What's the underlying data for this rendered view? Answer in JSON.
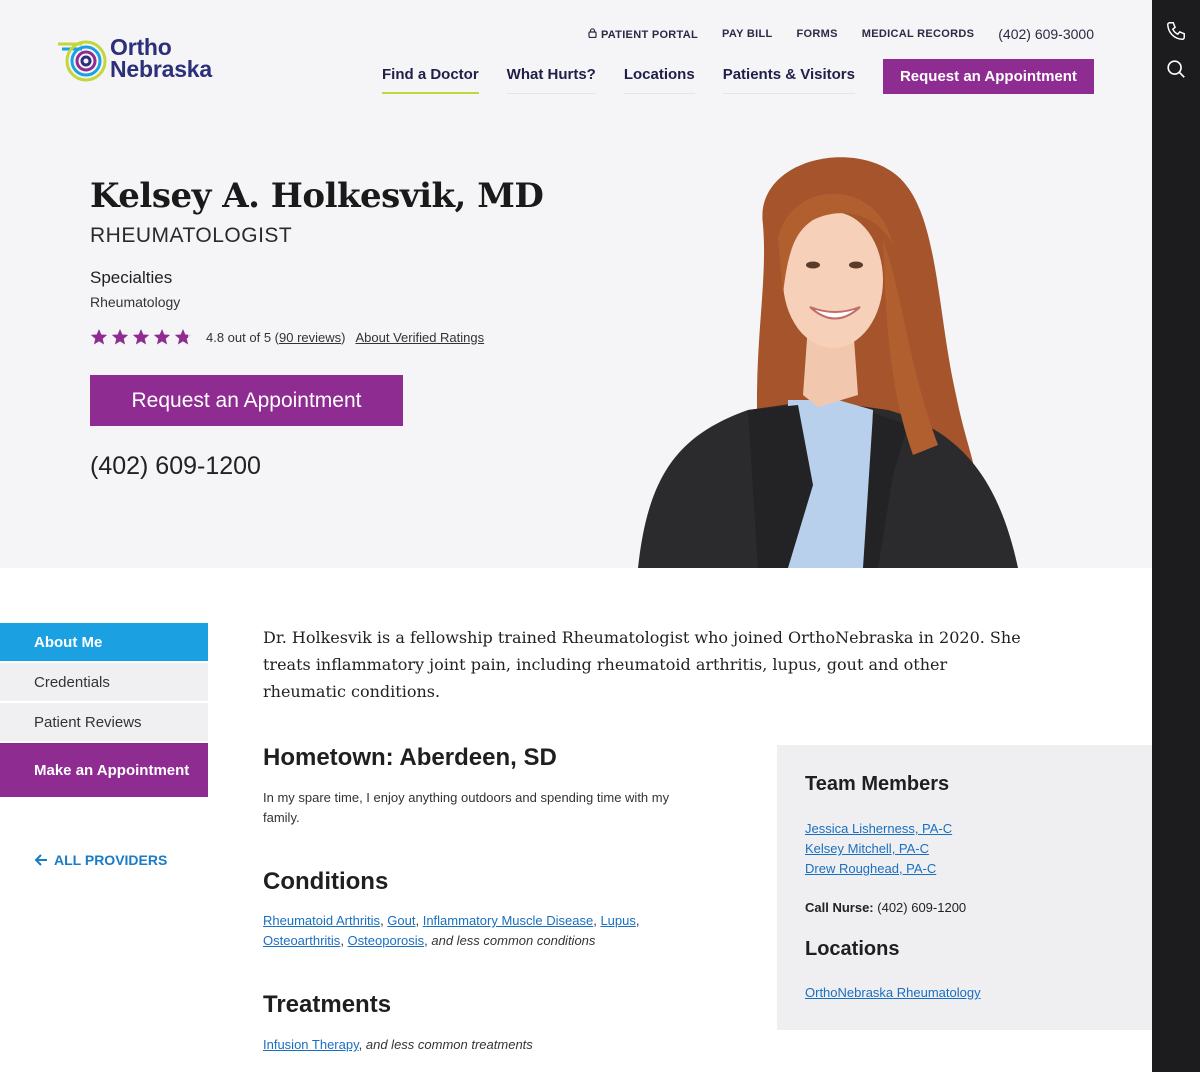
{
  "brand": {
    "line1": "Ortho",
    "line2": "Nebraska",
    "colors": {
      "purple": "#8e2c91",
      "navy": "#2c2f7a",
      "lime": "#c3d63a",
      "blue": "#1ba1e2"
    }
  },
  "utility_nav": {
    "patient_portal": "PATIENT PORTAL",
    "pay_bill": "PAY BILL",
    "forms": "FORMS",
    "medical_records": "MEDICAL RECORDS",
    "phone": "(402) 609-3000"
  },
  "main_nav": {
    "items": [
      "Find a Doctor",
      "What Hurts?",
      "Locations",
      "Patients & Visitors"
    ],
    "cta": "Request an Appointment"
  },
  "profile": {
    "name": "Kelsey A. Holkesvik, MD",
    "role": "RHEUMATOLOGIST",
    "specialties_heading": "Specialties",
    "specialties_value": "Rheumatology",
    "rating_value": 4.8,
    "rating_text": "4.8 out of 5 (",
    "reviews_link": "90 reviews",
    "rating_close": ")",
    "about_ratings": "About Verified Ratings",
    "cta": "Request an Appointment",
    "phone": "(402) 609-1200"
  },
  "sidebar": {
    "items": [
      "About Me",
      "Credentials",
      "Patient Reviews",
      "Make an Appointment"
    ],
    "all_providers": "ALL PROVIDERS"
  },
  "content": {
    "intro": "Dr. Holkesvik is a fellowship trained Rheumatologist who joined OrthoNebraska in 2020. She treats inflammatory joint pain, including rheumatoid arthritis, lupus, gout and other rheumatic conditions.",
    "hometown_heading": "Hometown: Aberdeen, SD",
    "hometown_text": "In my spare time, I enjoy anything outdoors and spending time with my family.",
    "conditions_heading": "Conditions",
    "conditions": [
      "Rheumatoid Arthritis",
      "Gout",
      "Inflammatory Muscle Disease",
      "Lupus",
      "Osteoarthritis",
      "Osteoporosis"
    ],
    "conditions_suffix": "and less common conditions",
    "treatments_heading": "Treatments",
    "treatments": [
      "Infusion Therapy"
    ],
    "treatments_suffix": "and less common treatments"
  },
  "panel": {
    "team_heading": "Team Members",
    "team": [
      "Jessica Lisherness, PA-C",
      "Kelsey Mitchell, PA-C",
      "Drew Roughead, PA-C"
    ],
    "nurse_label": "Call Nurse:",
    "nurse_phone": "(402) 609-1200",
    "locations_heading": "Locations",
    "locations": [
      "OrthoNebraska Rheumatology"
    ]
  },
  "icons": {
    "rail": [
      "phone-icon",
      "search-icon"
    ],
    "util": [
      "lock-icon"
    ],
    "back": "arrow-left-icon",
    "rating": "star-icon"
  }
}
